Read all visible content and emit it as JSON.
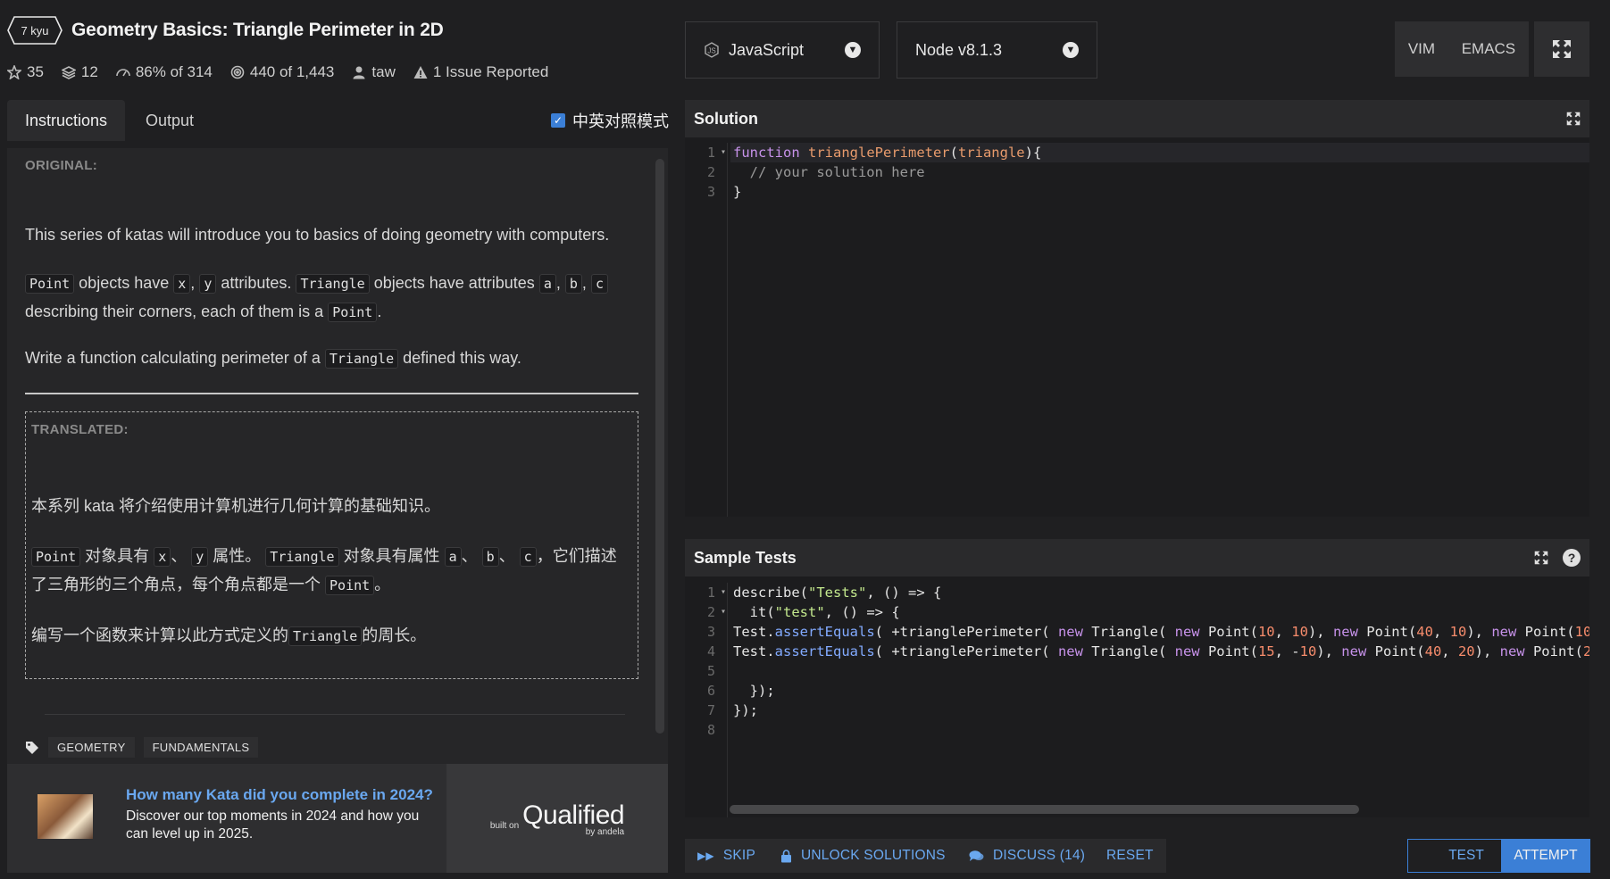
{
  "header": {
    "kyu": "7 kyu",
    "title": "Geometry Basics: Triangle Perimeter in 2D",
    "stats": {
      "stars": "35",
      "collections": "12",
      "satisfaction": "86% of 314",
      "completed": "440 of 1,443",
      "author": "taw",
      "issues": "1 Issue Reported"
    },
    "language": "JavaScript",
    "runtime": "Node v8.1.3",
    "mode_vim": "VIM",
    "mode_emacs": "EMACS"
  },
  "tabs": {
    "instructions": "Instructions",
    "output": "Output"
  },
  "bilingual_label": "中英对照模式",
  "original": {
    "label": "ORIGINAL:",
    "p1": "This series of katas will introduce you to basics of doing geometry with computers.",
    "p2": {
      "t1": "objects have",
      "point": "Point",
      "x": "x",
      "sep1": ",",
      "y": "y",
      "t2": "attributes.",
      "triangle": "Triangle",
      "t3": "objects have attributes",
      "a": "a",
      "b": "b",
      "c": "c",
      "t4": "describing their corners, each of them is a",
      "end": "."
    },
    "p3": {
      "t1": "Write a function calculating perimeter of a",
      "triangle": "Triangle",
      "t2": "defined this way."
    }
  },
  "translated": {
    "label": "TRANSLATED:",
    "p1": "本系列 kata 将介绍使用计算机进行几何计算的基础知识。",
    "p2": {
      "point": "Point",
      "t1": "对象具有",
      "x": "x",
      "sep": "、",
      "y": "y",
      "t2": "属性。",
      "triangle": "Triangle",
      "t3": "对象具有属性",
      "a": "a",
      "b": "b",
      "c": "c",
      "t4": "，它们描述了三角形的三个角点，每个角点都是一个",
      "end": "。"
    },
    "p3": {
      "t1": "编写一个函数来计算以此方式定义的",
      "triangle": "Triangle",
      "t2": "的周长。"
    }
  },
  "tags": [
    "GEOMETRY",
    "FUNDAMENTALS"
  ],
  "promo": {
    "title": "How many Kata did you complete in 2024?",
    "desc": "Discover our top moments in 2024 and how you can level up in 2025.",
    "built_on": "built on",
    "brand": "Qualified",
    "by": "by andela"
  },
  "solution": {
    "title": "Solution",
    "lines": [
      "1",
      "2",
      "3"
    ]
  },
  "sample_tests": {
    "title": "Sample Tests",
    "lines": [
      "1",
      "2",
      "3",
      "4",
      "5",
      "6",
      "7",
      "8"
    ]
  },
  "buttons": {
    "skip": "SKIP",
    "unlock": "UNLOCK SOLUTIONS",
    "discuss": "DISCUSS (14)",
    "reset": "RESET",
    "test": "TEST",
    "attempt": "ATTEMPT"
  }
}
